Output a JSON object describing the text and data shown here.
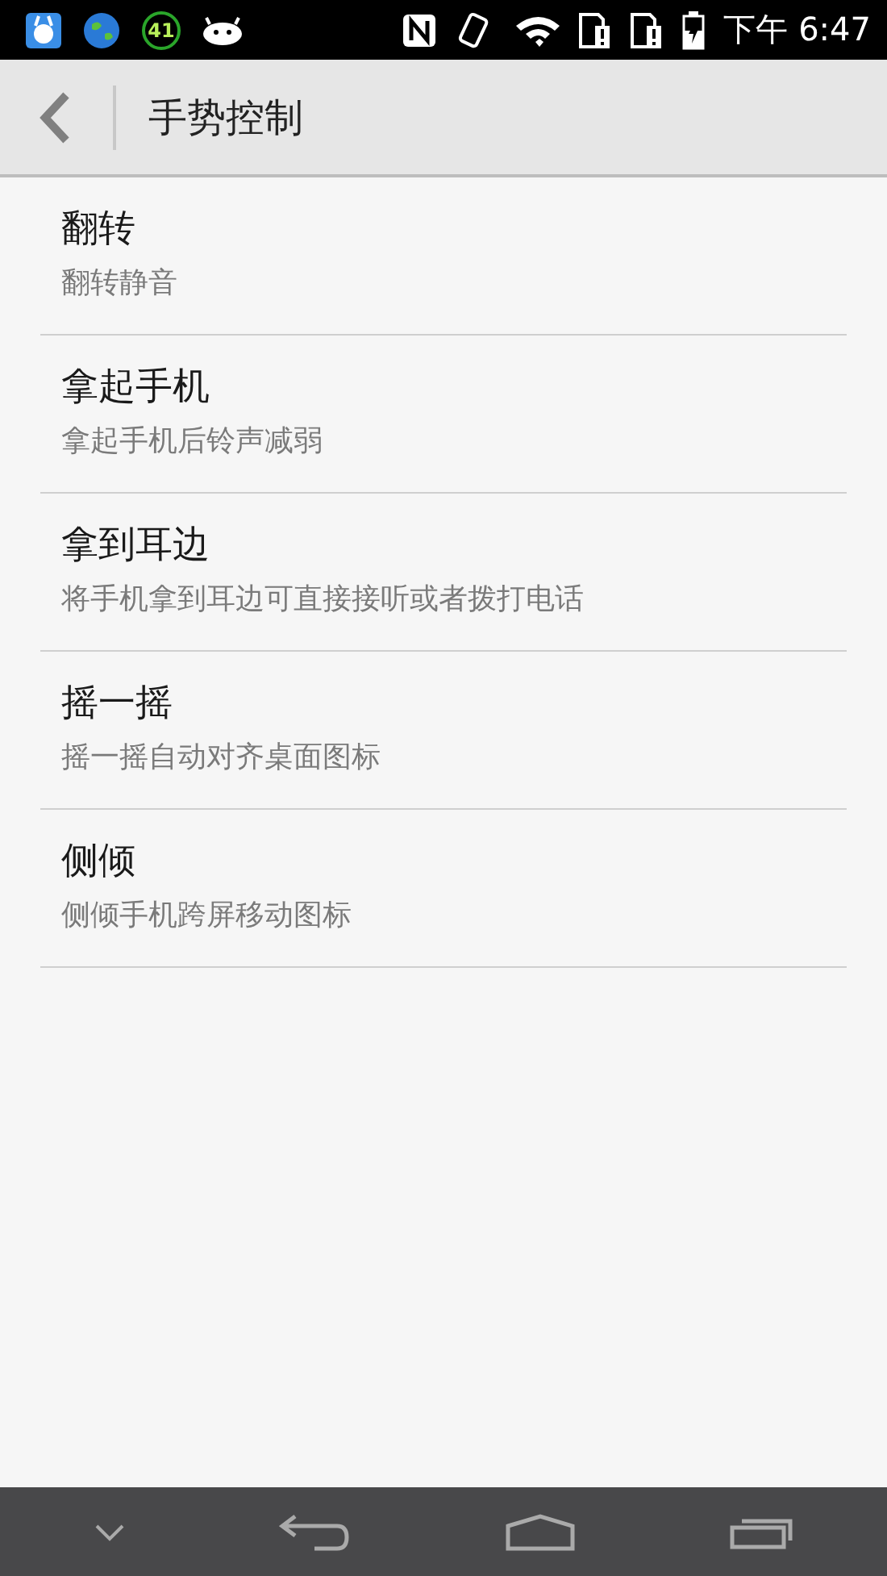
{
  "status_bar": {
    "badge_count": "41",
    "time": "下午 6:47"
  },
  "header": {
    "title": "手势控制"
  },
  "items": [
    {
      "title": "翻转",
      "subtitle": "翻转静音"
    },
    {
      "title": "拿起手机",
      "subtitle": "拿起手机后铃声减弱"
    },
    {
      "title": "拿到耳边",
      "subtitle": "将手机拿到耳边可直接接听或者拨打电话"
    },
    {
      "title": "摇一摇",
      "subtitle": "摇一摇自动对齐桌面图标"
    },
    {
      "title": "侧倾",
      "subtitle": "侧倾手机跨屏移动图标"
    }
  ]
}
